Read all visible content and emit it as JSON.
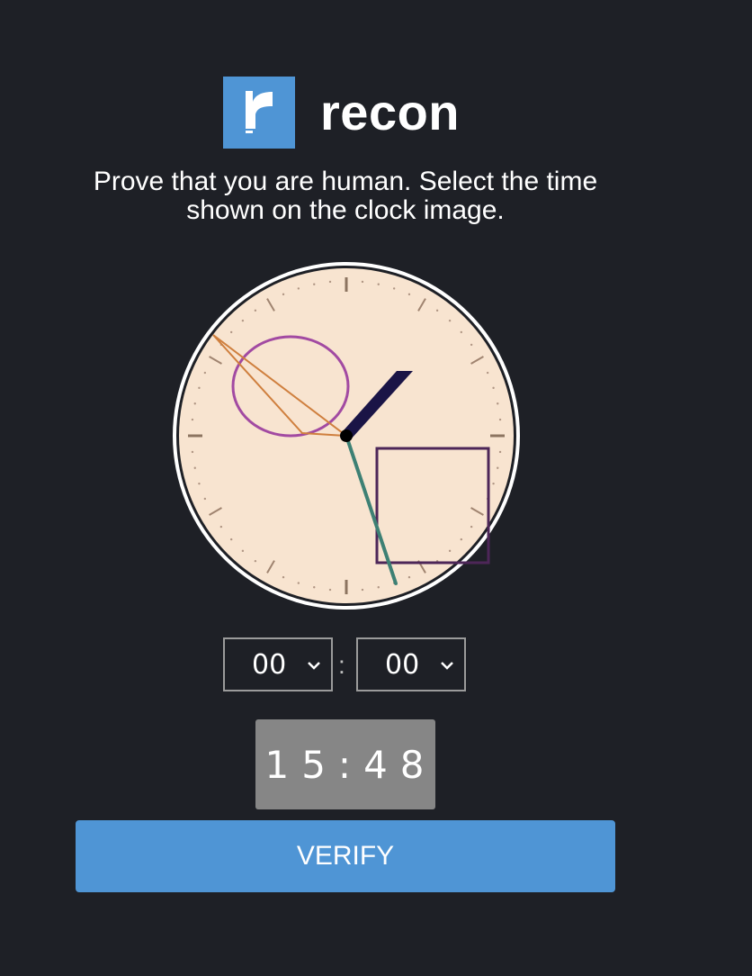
{
  "brand": {
    "name": "recon",
    "logo_icon": "recon-r-logo-icon",
    "logo_color": "#4f95d5"
  },
  "captcha": {
    "instructions": "Prove that you are human. Select the time shown on the clock image.",
    "clock_icon": "analog-clock-icon",
    "hour_select": {
      "value": "00"
    },
    "minute_select": {
      "value": "00"
    },
    "separator": ":",
    "time_display": "15:48",
    "verify_label": "VERIFY"
  },
  "colors": {
    "background": "#1e2026",
    "accent": "#4f95d5",
    "clock_face": "#f8e4d0",
    "display_bg": "#868686"
  }
}
